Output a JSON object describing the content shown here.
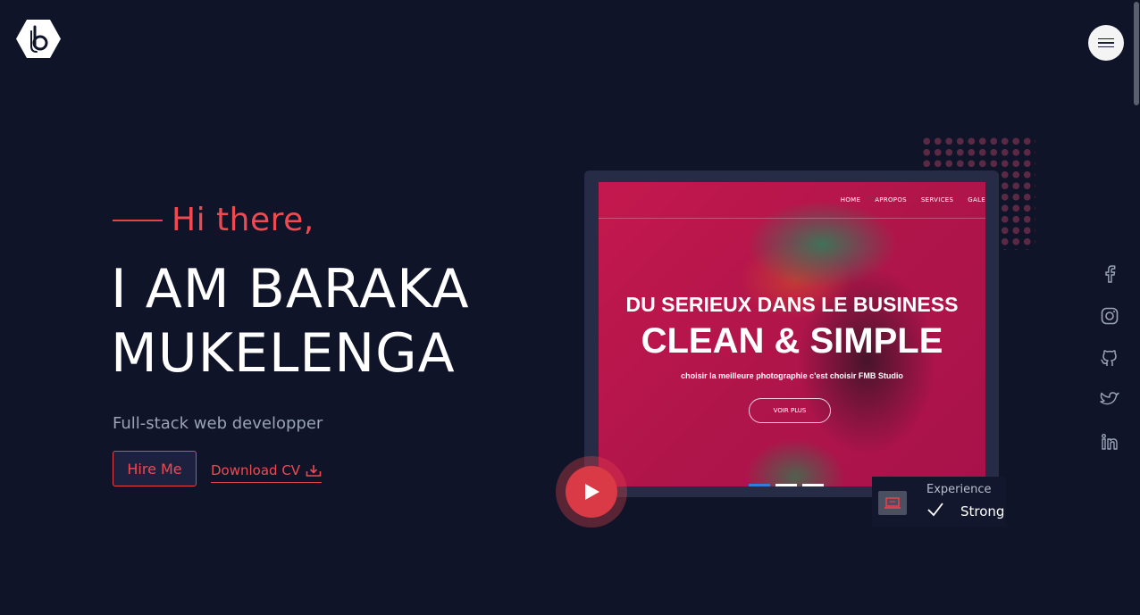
{
  "header": {
    "logo_icon": "b-hexagon-logo",
    "menu_icon": "hamburger-menu-icon"
  },
  "hero": {
    "greeting": "Hi there,",
    "name_line1": "I AM BARAKA",
    "name_line2": "MUKELENGA",
    "role": "Full-stack web developper",
    "hire_label": "Hire Me",
    "cv_label": "Download CV",
    "cv_icon": "download-icon"
  },
  "mockup": {
    "nav": [
      "HOME",
      "APROPOS",
      "SERVICES",
      "GALE"
    ],
    "heading1": "DU SERIEUX DANS LE BUSINESS",
    "heading2": "CLEAN & SIMPLE",
    "subtitle": "choisir la meilleure photographie c'est choisir FMB Studio",
    "button": "VOIR PLUS"
  },
  "experience": {
    "label": "Experience",
    "value": "Strong",
    "icon": "laptop-icon",
    "check_icon": "check-icon"
  },
  "socials": [
    "facebook-icon",
    "instagram-icon",
    "github-icon",
    "twitter-icon",
    "linkedin-icon"
  ],
  "colors": {
    "background": "#0f1429",
    "accent": "#e5424a",
    "muted_text": "#9aa3b8"
  }
}
